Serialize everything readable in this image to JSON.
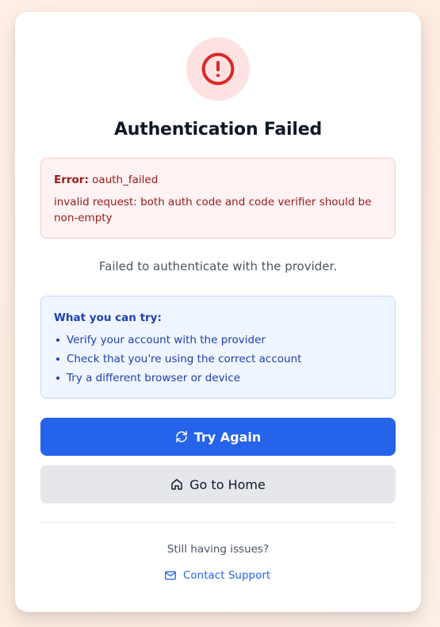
{
  "card": {
    "title": "Authentication Failed",
    "status_icon": "alert-circle-icon"
  },
  "error": {
    "label": "Error:",
    "code": "oauth_failed",
    "detail": "invalid request: both auth code and code verifier should be non-empty"
  },
  "message": "Failed to authenticate with the provider.",
  "tips": {
    "title": "What you can try:",
    "items": [
      "Verify your account with the provider",
      "Check that you're using the correct account",
      "Try a different browser or device"
    ]
  },
  "buttons": {
    "try_again": {
      "label": "Try Again",
      "icon": "refresh-icon"
    },
    "go_home": {
      "label": "Go to Home",
      "icon": "home-icon"
    }
  },
  "help": {
    "text": "Still having issues?",
    "contact_label": "Contact Support",
    "contact_icon": "mail-icon"
  },
  "colors": {
    "primary": "#2563eb",
    "error_text": "#991b1b",
    "error_bg": "#fef2f2",
    "error_icon": "#dc2626",
    "info_text": "#1e40af",
    "info_bg": "#eff6ff",
    "secondary_bg": "#e5e7eb"
  }
}
